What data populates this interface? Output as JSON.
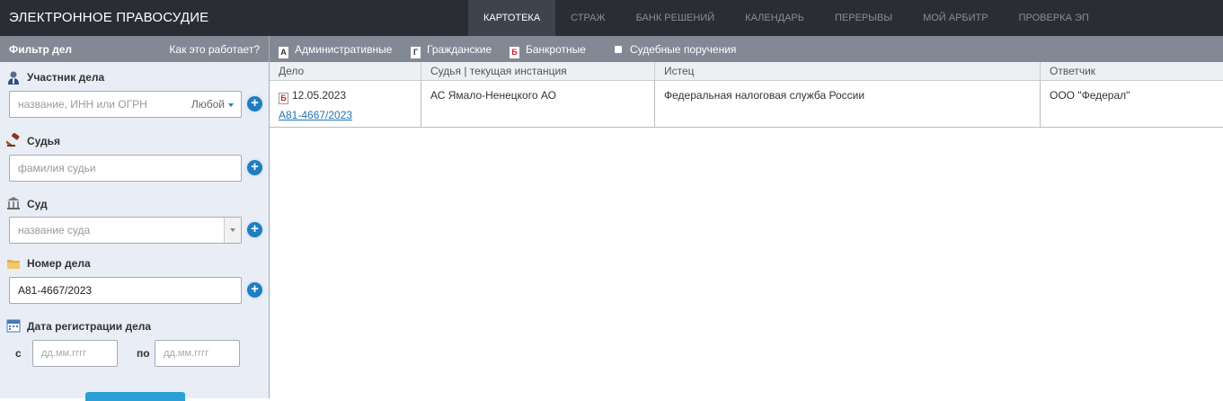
{
  "header": {
    "brand": "ЭЛЕКТРОННОЕ ПРАВОСУДИЕ",
    "nav": [
      "КАРТОТЕКА",
      "СТРАЖ",
      "БАНК РЕШЕНИЙ",
      "КАЛЕНДАРЬ",
      "ПЕРЕРЫВЫ",
      "МОЙ АРБИТР",
      "ПРОВЕРКА ЭП"
    ],
    "active_nav": "КАРТОТЕКА"
  },
  "sidebar": {
    "title": "Фильтр дел",
    "help_link": "Как это работает?",
    "participant": {
      "label": "Участник дела",
      "placeholder": "название, ИНН или ОГРН",
      "role": "Любой"
    },
    "judge": {
      "label": "Судья",
      "placeholder": "фамилия судьи"
    },
    "court": {
      "label": "Суд",
      "placeholder": "название суда"
    },
    "case_number": {
      "label": "Номер дела",
      "value": "А81-4667/2023"
    },
    "reg_date": {
      "label": "Дата регистрации дела",
      "from_label": "с",
      "to_label": "по",
      "from_placeholder": "дд.мм.гггг",
      "to_placeholder": "дд.мм.гггг"
    }
  },
  "filters": {
    "admin": {
      "icon": "А",
      "label": "Административные"
    },
    "civil": {
      "icon": "Г",
      "label": "Гражданские"
    },
    "bankruptcy": {
      "icon": "Б",
      "label": "Банкротные"
    },
    "court_orders": {
      "label": "Судебные поручения"
    }
  },
  "table": {
    "columns": [
      "Дело",
      "Судья | текущая инстанция",
      "Истец",
      "Ответчик"
    ],
    "rows": [
      {
        "type_icon": "Б",
        "date": "12.05.2023",
        "case_number": "А81-4667/2023",
        "court": "АС Ямало-Ненецкого АО",
        "plaintiff": "Федеральная налоговая служба России",
        "defendant": "ООО \"Федерал\""
      }
    ]
  },
  "colors": {
    "topbar": "#2a2d34",
    "filterbar": "#828894",
    "sidebar": "#e8edf6",
    "accent": "#1d7ec2",
    "link": "#1e72b6"
  }
}
